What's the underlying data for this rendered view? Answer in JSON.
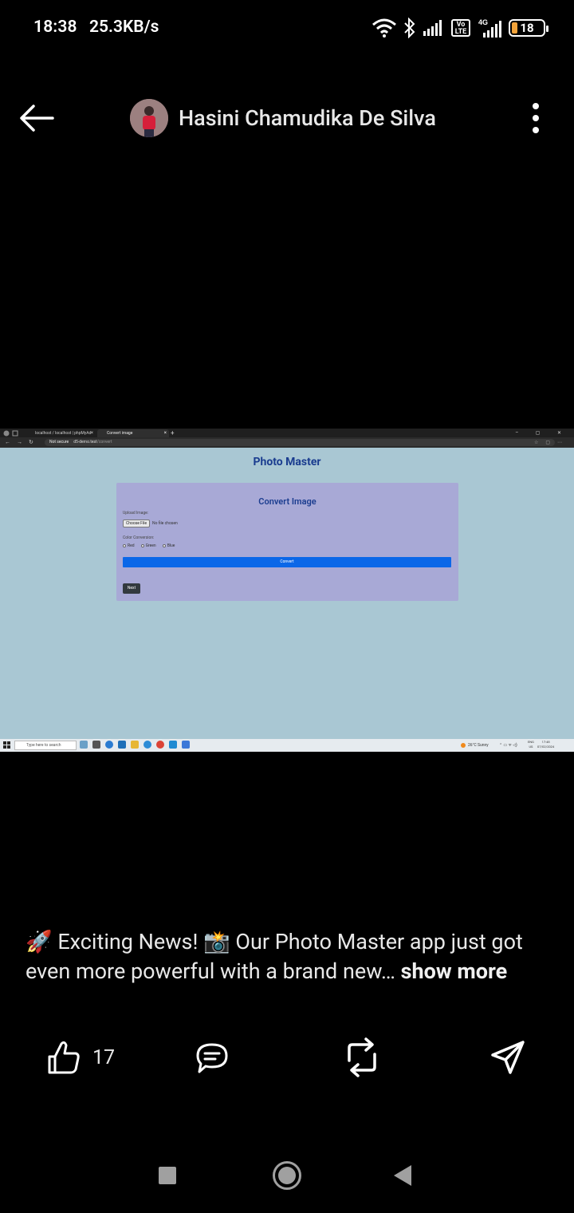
{
  "status_bar": {
    "time": "18:38",
    "net_speed": "25.3KB/s",
    "volte_label": "Vo\nLTE",
    "network_label": "4G",
    "battery": "18",
    "battery_level_percent": 18,
    "battery_color": "#f2a33a"
  },
  "post": {
    "author": "Hasini Chamudika De Silva",
    "caption_text": "🚀 Exciting News! 📸 Our Photo Master app just got even more powerful with a brand new… ",
    "show_more": "show more",
    "like_count": "17"
  },
  "embedded_screenshot": {
    "browser": {
      "tab1": "localhost / localhost | phpMyAd",
      "tab2": "Convert image",
      "new_tab": "+",
      "window_controls": "– ▢ ✕",
      "not_secure": "Not secure",
      "url_host": "d5-demo.test",
      "url_path": "/convert"
    },
    "app": {
      "site_title": "Photo Master",
      "card_title": "Convert Image",
      "upload_label": "Upload Image:",
      "choose_file": "Choose File",
      "file_status": "No file chosen",
      "color_label": "Color Conversion:",
      "radio_options": [
        "Red",
        "Green",
        "Blue"
      ],
      "convert_button": "Convert",
      "next_button": "Next",
      "accent_color": "#0b67e8",
      "page_bg": "#a9c7d3",
      "card_bg": "#a8a9d6"
    },
    "taskbar": {
      "search_placeholder": "Type here to search",
      "weather": "26°C  Sunny",
      "lang_top": "ENG",
      "lang_bottom": "US",
      "clock_time": "17:48",
      "clock_date": "07/02/2024"
    }
  },
  "icons": {
    "back": "arrow-left-icon",
    "menu": "more-vertical-icon",
    "like": "thumbs-up-icon",
    "comment": "comment-icon",
    "repost": "repost-icon",
    "send": "send-icon"
  }
}
